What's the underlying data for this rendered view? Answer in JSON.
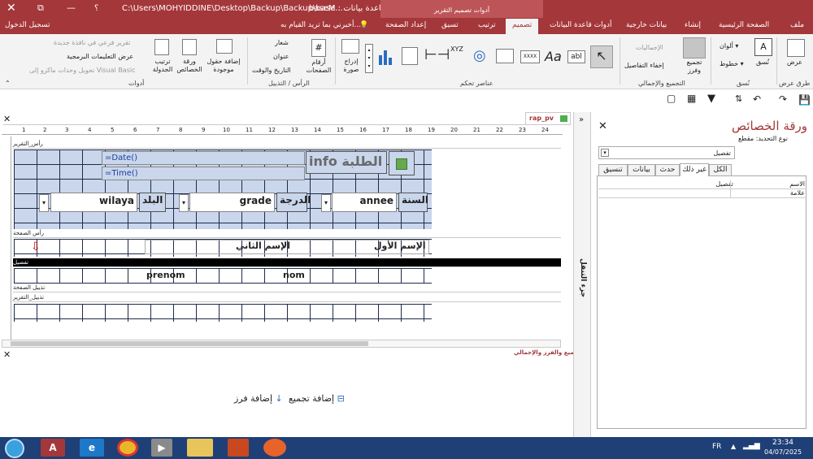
{
  "titlebar": {
    "path": "C:\\Users\\MOHYIDDINE\\Desktop\\Backup\\Backup\\base...",
    "db": "baseM : قاعدة بيانات",
    "help": "؟",
    "signin": "تسجيل الدخول",
    "context": "أدوات تصميم التقرير"
  },
  "tabs": [
    "ملف",
    "الصفحة الرئيسية",
    "إنشاء",
    "بيانات خارجية",
    "أدوات قاعدة البيانات",
    "تصميم",
    "ترتيب",
    "تسيق",
    "إعداد الصفحة"
  ],
  "tellme": "أخبرني بما تريد القيام به...",
  "ribbon": {
    "views": {
      "label": "عرض",
      "group": "طرق عرض"
    },
    "themes": {
      "theme": "نُسق",
      "colors": "ألوان",
      "fonts": "خطوط",
      "group": "نُسق"
    },
    "grouping": {
      "group_sort": "تجميع وفرز",
      "totals": "الإجماليات",
      "hide": "إخفاء التفاصيل",
      "group": "التجميع والإجمالي"
    },
    "controls": {
      "group": "عناصر تحكم",
      "insert_image": "إدراج صورة",
      "xyz": "XYZ",
      "xxxx": "XXXX",
      "aa": "Aa",
      "abl": "abl"
    },
    "header": {
      "page_numbers": "أرقام الصفحات",
      "logo": "شعار",
      "title": "عنوان",
      "datetime": "التاريخ والوقت",
      "group": "الرأس / التذييل"
    },
    "tools": {
      "add_fields": "إضافة حقول موجودة",
      "property_sheet": "ورقة الخصائص",
      "tab_order": "ترتيب الجدولة",
      "subreport": "تقرير فرعي في نافذة جديدة",
      "view_code": "عرض التعليمات البرمجية",
      "convert": "تحويل وحدات ماكرو إلى Visual Basic",
      "group": "أدوات"
    }
  },
  "doc": {
    "tab": "rap_pv",
    "sections": {
      "report_header": "رأس_التقرير",
      "page_header": "رأس الصفحة",
      "detail": "تفصيل",
      "page_footer": "تذييل الصفحة",
      "report_footer": "تذييل_التقرير"
    },
    "date_expr": "=Date()",
    "time_expr": "=Time()",
    "title_info": "info",
    "title_ar": "الطلبة",
    "fields": {
      "annee": "annee",
      "annee_lbl": "السنة",
      "grade": "grade",
      "grade_lbl": "الدرجة",
      "wilaya": "wilaya",
      "wilaya_lbl": "البلد"
    },
    "header_labels": {
      "first": "الإسم الأول",
      "second": "الإسم الثاني"
    },
    "detail_fields": {
      "prenom": "prenom",
      "nom": "nom"
    },
    "ruler": [
      "1",
      "2",
      "3",
      "4",
      "5",
      "6",
      "7",
      "8",
      "9",
      "10",
      "11",
      "12",
      "13",
      "14",
      "15",
      "16",
      "17",
      "18",
      "19",
      "20",
      "21",
      "22",
      "23",
      "24"
    ]
  },
  "group_pane": {
    "title": "التجميع والفرز والإجمالي",
    "add_group": "إضافة تجميع",
    "add_sort": "إضافة فرز"
  },
  "navpane": {
    "label": "جزء التنقل"
  },
  "props": {
    "title": "ورقة الخصائص",
    "selection_type": "نوع التحديد: مقطع",
    "selected": "تفصيل",
    "tabs": [
      "الكل",
      "غير ذلك",
      "حدث",
      "بيانات",
      "تنسيق"
    ],
    "rows": [
      {
        "name": "الاسم",
        "value": "تفصيل"
      },
      {
        "name": "علامة",
        "value": ""
      }
    ]
  },
  "taskbar": {
    "lang": "FR",
    "time": "23:34",
    "date": "04/07/2025"
  },
  "colors": {
    "accent": "#a4373a",
    "selection": "#c9d6ec"
  }
}
